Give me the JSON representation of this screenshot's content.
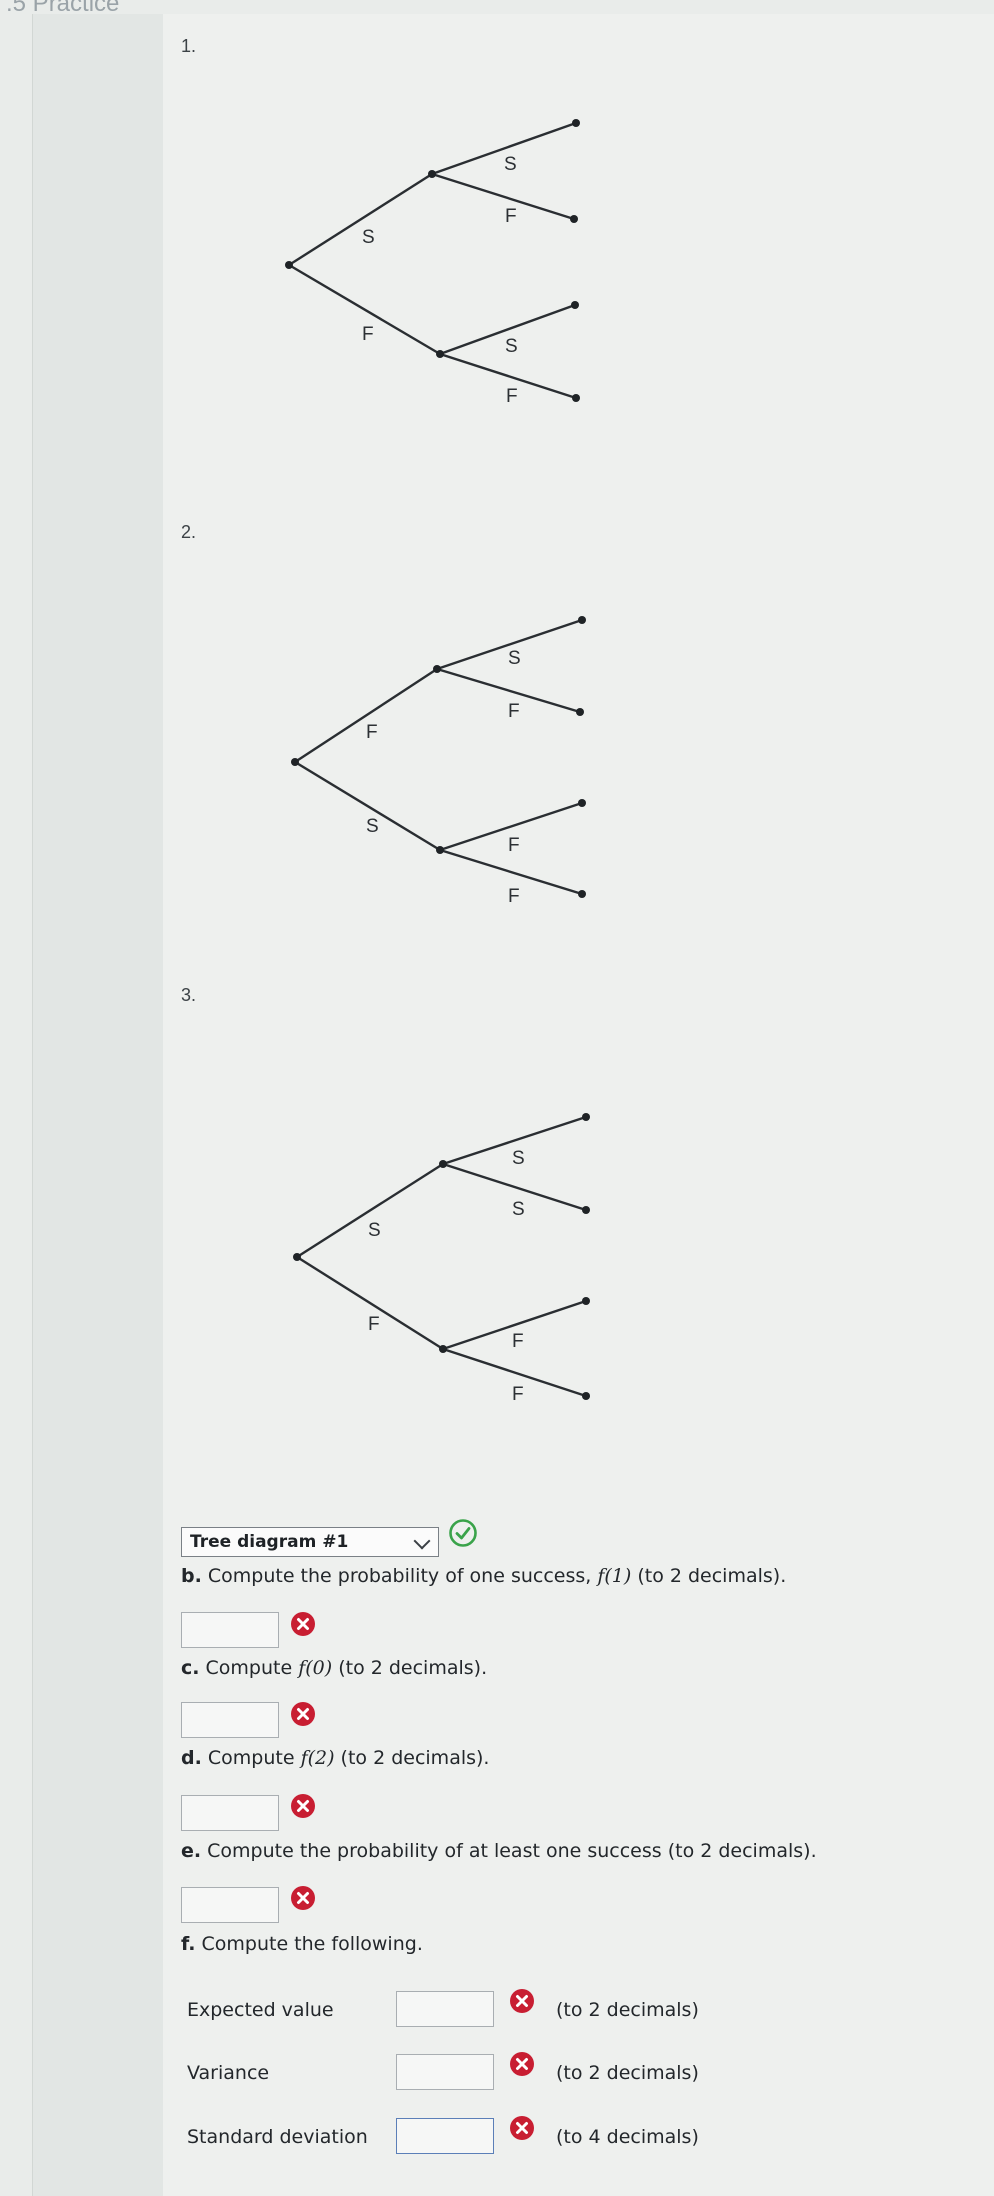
{
  "header": {
    "title": ".5 Practice"
  },
  "questions": [
    {
      "number": "1.",
      "labels": [
        "S",
        "F",
        "S",
        "F",
        "S",
        "F"
      ]
    },
    {
      "number": "2.",
      "labels": [
        "F",
        "S",
        "S",
        "F",
        "F",
        "F"
      ]
    },
    {
      "number": "3.",
      "labels": [
        "S",
        "F",
        "S",
        "S",
        "F",
        "F"
      ]
    }
  ],
  "dropdown": {
    "selected": "Tree diagram #1"
  },
  "parts": {
    "b": {
      "letter": "b.",
      "text": "Compute the probability of one success, ",
      "fx": "f(1)",
      "suffix": " (to 2 decimals)."
    },
    "c": {
      "letter": "c.",
      "text": "Compute ",
      "fx": "f(0)",
      "suffix": " (to 2 decimals)."
    },
    "d": {
      "letter": "d.",
      "text": "Compute ",
      "fx": "f(2)",
      "suffix": " (to 2 decimals)."
    },
    "e": {
      "letter": "e.",
      "text": "Compute the probability of at least one success (to 2 decimals)."
    },
    "f": {
      "letter": "f.",
      "text": "Compute the following."
    }
  },
  "rows": [
    {
      "label": "Expected value",
      "hint": "(to 2 decimals)"
    },
    {
      "label": "Variance",
      "hint": "(to 2 decimals)"
    },
    {
      "label": "Standard deviation",
      "hint": "(to 4 decimals)"
    }
  ],
  "colors": {
    "correct": "#3aa34a",
    "incorrect": "#c81e32"
  }
}
